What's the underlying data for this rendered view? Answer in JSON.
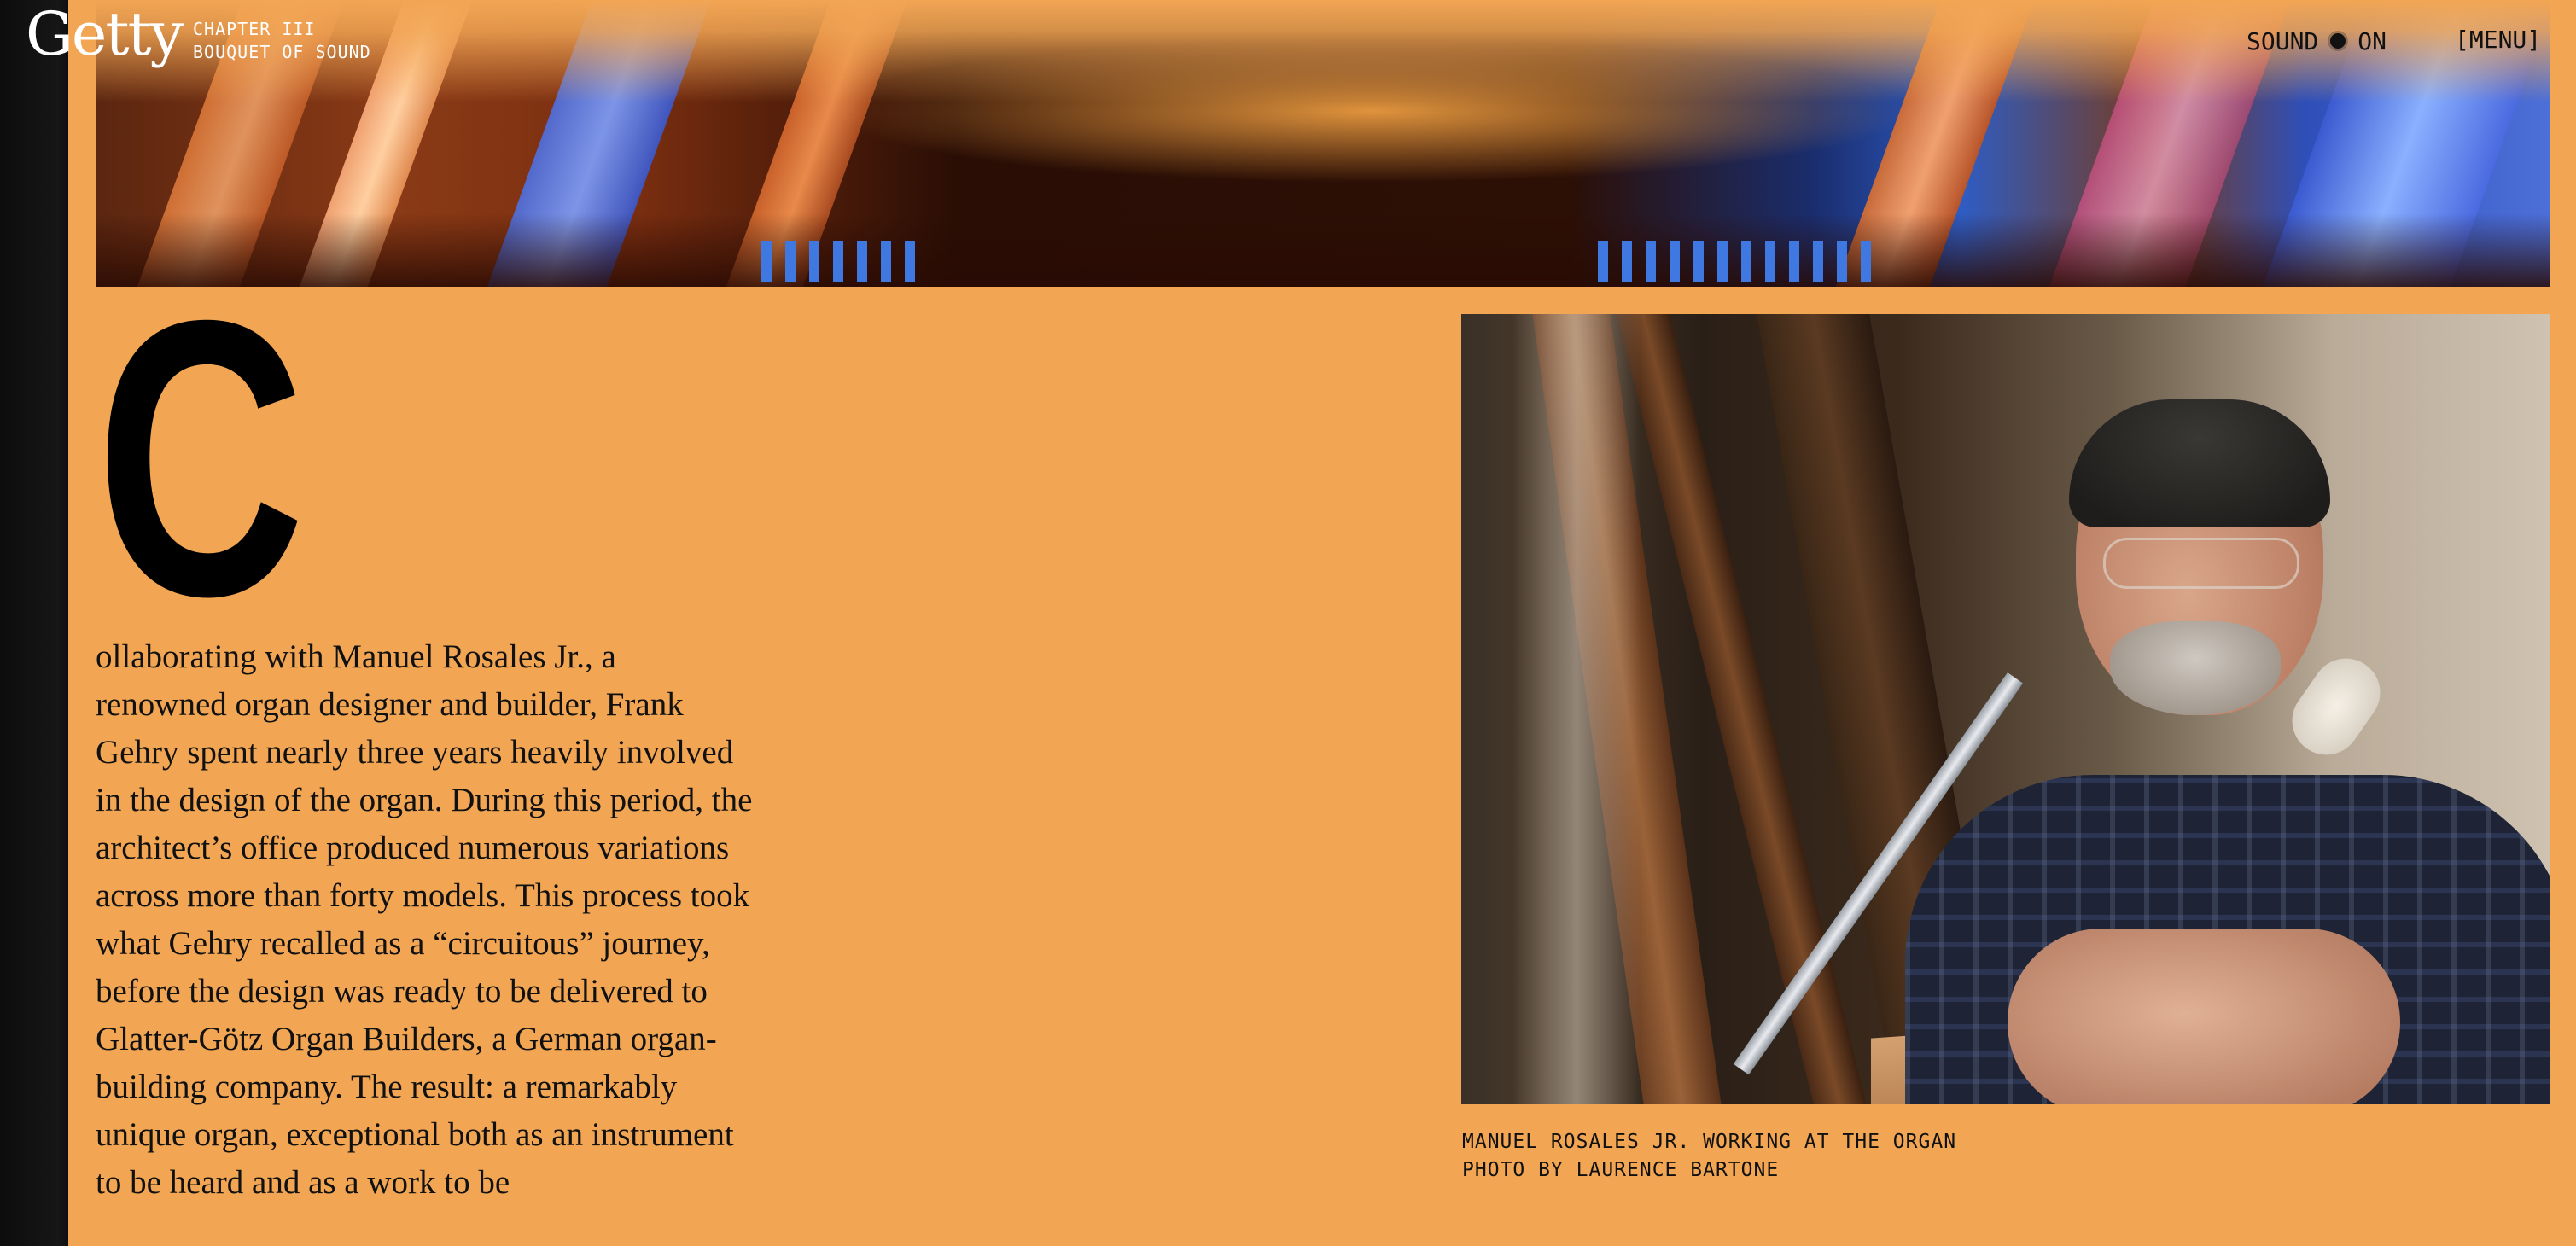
{
  "header": {
    "logo": "Getty",
    "chapter_number": "CHAPTER III",
    "chapter_title": "BOUQUET OF SOUND",
    "sound_label": "SOUND",
    "sound_state": "ON",
    "menu_label": "[MENU]"
  },
  "article": {
    "drop_cap": "C",
    "body": "ollaborating with Manuel Rosales Jr., a renowned organ designer and builder, Frank Gehry spent nearly three years heavily involved in the design of the organ. During this period, the architect’s office produced numerous variations across more than forty models. This process took what Gehry recalled as a “circuitous” journey, before the design was ready to be delivered to Glatter-Götz Organ Builders, a German organ-building company. The result: a remarkably unique organ, exceptional both as an instrument to be heard and as a work to be"
  },
  "figure": {
    "caption_line1": "MANUEL ROSALES JR. WORKING AT THE ORGAN",
    "caption_line2": "PHOTO BY LAURENCE BARTONE"
  },
  "colors": {
    "background": "#F2A654",
    "text": "#111111",
    "rail": "#111111"
  }
}
